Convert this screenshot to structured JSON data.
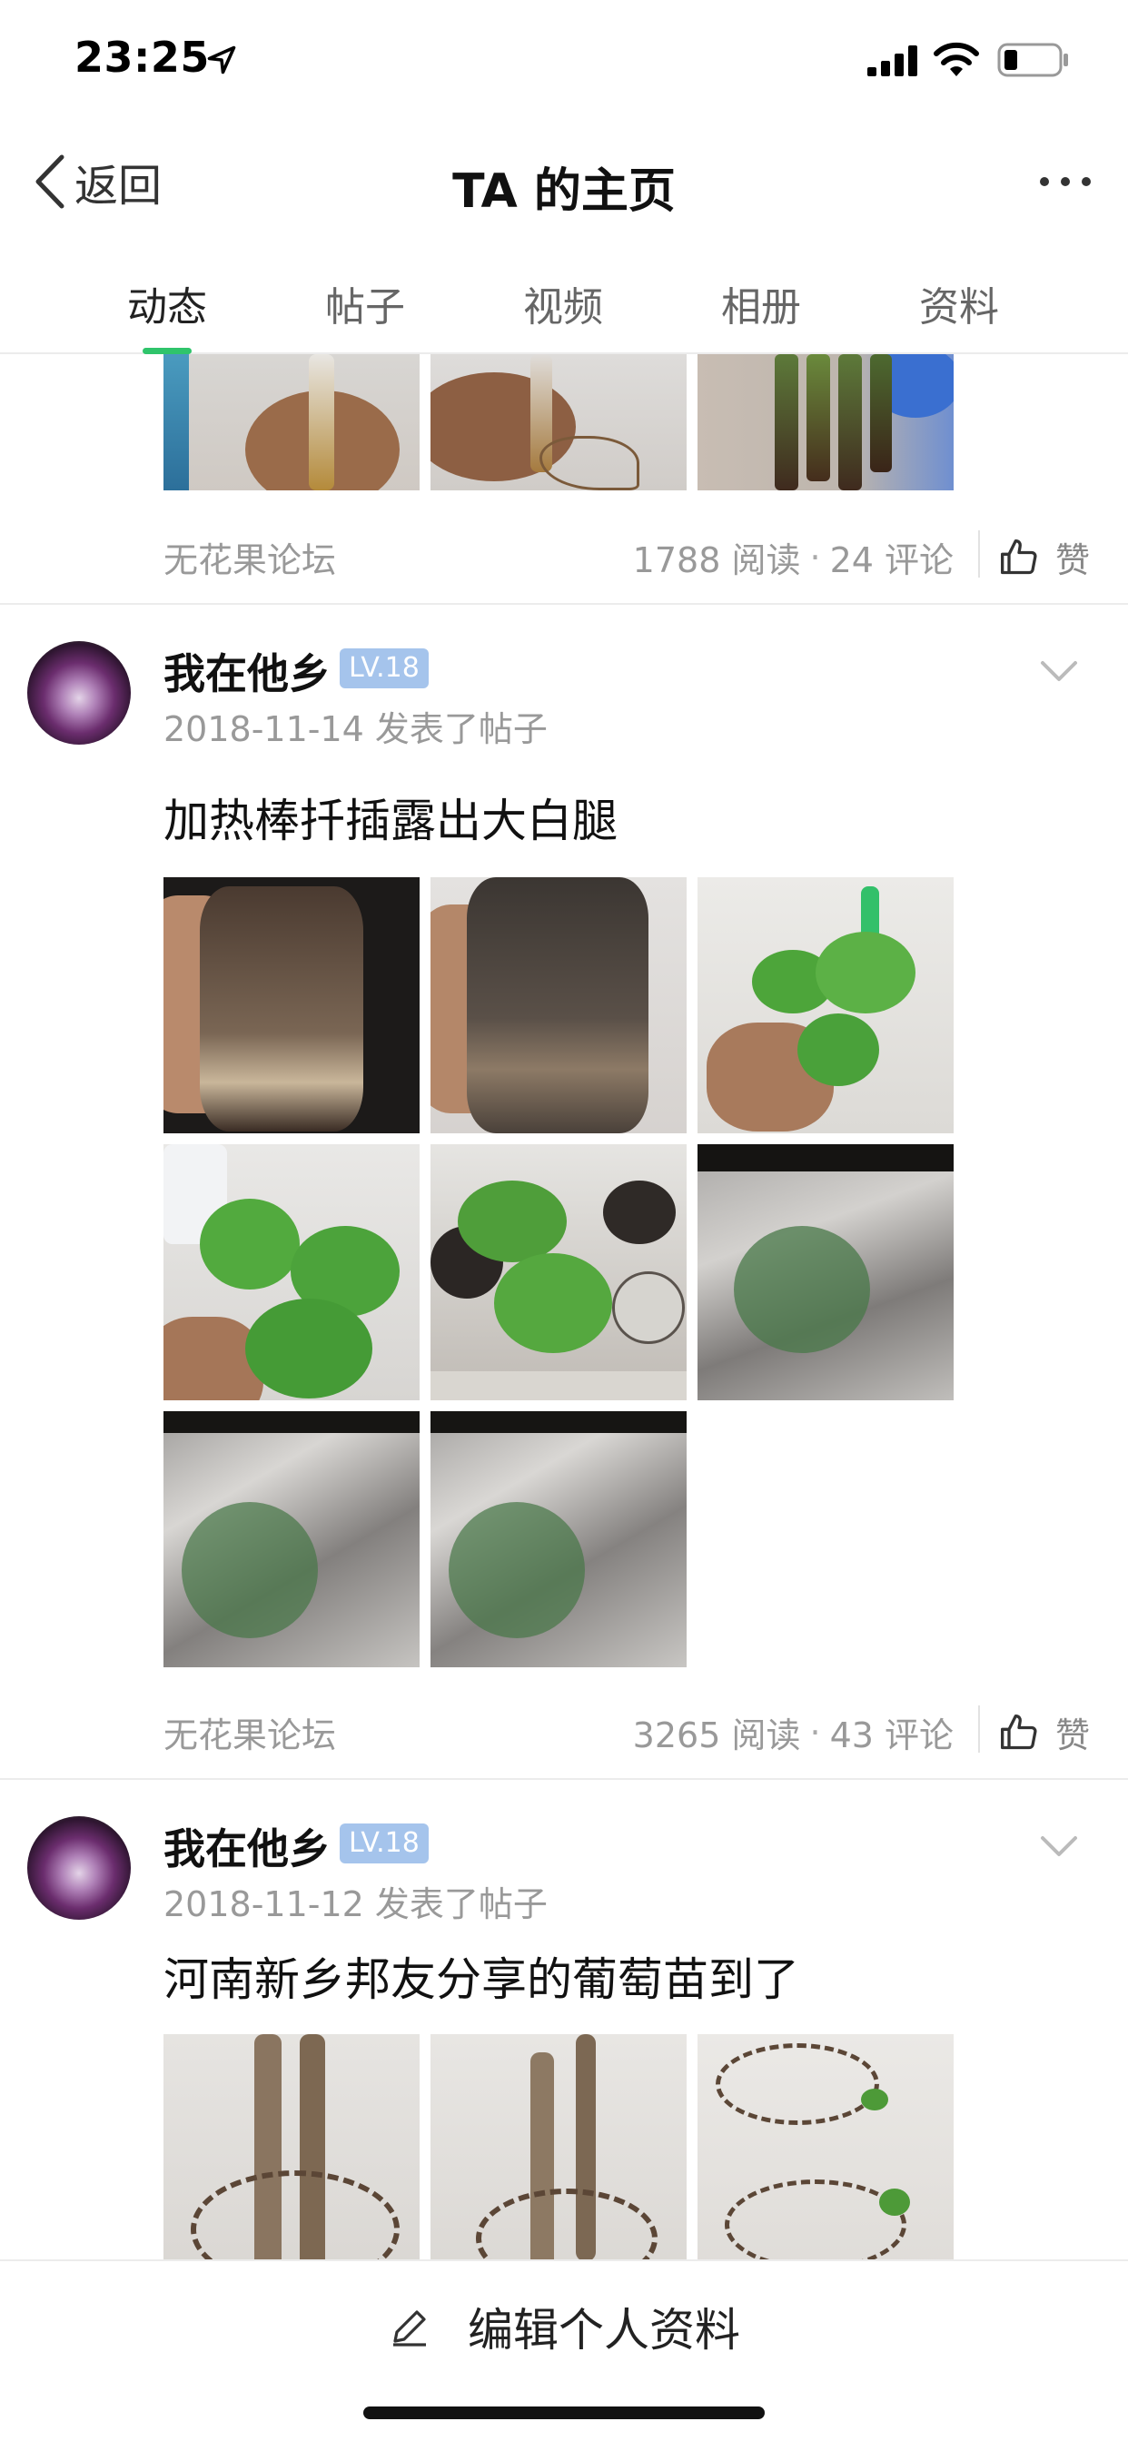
{
  "status_bar": {
    "time": "23:25",
    "icons": [
      "location-arrow-icon",
      "cellular-signal-icon",
      "wifi-icon",
      "battery-icon"
    ]
  },
  "nav": {
    "back_label": "返回",
    "title": "TA 的主页",
    "more_icon": "more-dots-icon"
  },
  "tabs": [
    {
      "label": "动态",
      "active": true
    },
    {
      "label": "帖子",
      "active": false
    },
    {
      "label": "视频",
      "active": false
    },
    {
      "label": "相册",
      "active": false
    },
    {
      "label": "资料",
      "active": false
    }
  ],
  "colors": {
    "accent_green": "#2fc46b",
    "level_badge": "#a5c4ec",
    "muted_text": "#999999"
  },
  "posts": [
    {
      "forum": "无花果论坛",
      "reads": "1788 阅读",
      "comments": "24 评论",
      "like_label": "赞"
    },
    {
      "author": "我在他乡",
      "level": "LV.18",
      "date_action": "2018-11-14 发表了帖子",
      "title": "加热棒扦插露出大白腿",
      "photo_count": 8,
      "forum": "无花果论坛",
      "reads": "3265 阅读",
      "comments": "43 评论",
      "like_label": "赞"
    },
    {
      "author": "我在他乡",
      "level": "LV.18",
      "date_action": "2018-11-12 发表了帖子",
      "title": "河南新乡邦友分享的葡萄苗到了",
      "photo_count": 3
    }
  ],
  "bottom": {
    "edit_label": "编辑个人资料",
    "edit_icon": "pencil-icon"
  }
}
